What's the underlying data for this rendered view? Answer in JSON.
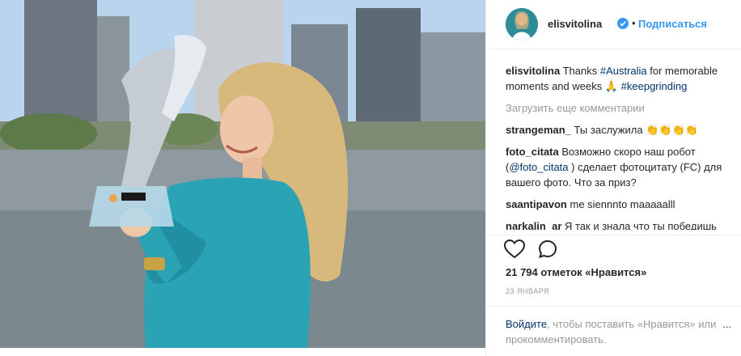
{
  "post": {
    "username": "elisvitolina",
    "separator": "•",
    "follow_label": "Подписаться",
    "caption": {
      "author": "elisvitolina",
      "text_before": "Thanks ",
      "link_1": "#Australia",
      "text_mid": " for memorable moments and weeks 🙏",
      "link_2": "#keepgrinding"
    },
    "load_more_label": "Загрузить еще комментарии",
    "comments": [
      {
        "author": "strangeman_",
        "text": "Ты заслужила 👏👏👏👏"
      },
      {
        "author": "foto_citata",
        "text_before": "Возможно скоро наш робот (",
        "mention": "@foto_citata",
        "text_after": " ) сделает фотоцитату (FC) для вашего фото. Что за приз?"
      },
      {
        "author": "saantipavon",
        "text": "me siennnto maaaaalll"
      },
      {
        "author": "narkalin_ar",
        "text": "Я так и знала что ты победишь"
      }
    ],
    "likes": "21 794 отметок «Нравится»",
    "date": "23 ЯНВАРЯ",
    "login_link": "Войдите",
    "login_text": ", чтобы поставить «Нравится» или прокомментировать.",
    "more_options": "..."
  },
  "icons": {
    "like": "heart-icon",
    "comment": "comment-icon",
    "verified": "verified-badge-icon"
  },
  "colors": {
    "accent": "#3897f0",
    "link": "#003569",
    "muted": "#999999"
  }
}
